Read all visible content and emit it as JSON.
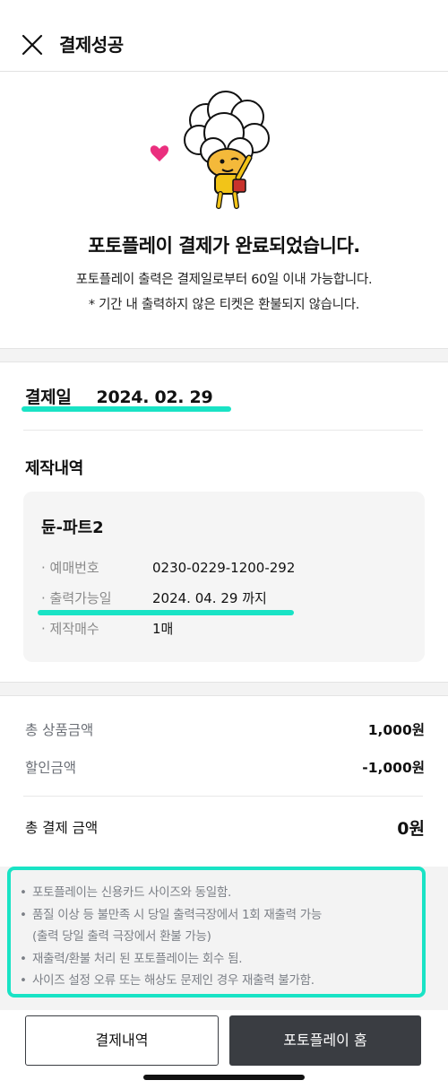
{
  "header": {
    "title": "결제성공",
    "close_icon": "close-icon"
  },
  "hero": {
    "mascot_icon": "popcorn-mascot-heart-icon",
    "title": "포토플레이 결제가 완료되었습니다.",
    "sub1": "포토플레이 출력은 결제일로부터 60일 이내 가능합니다.",
    "sub2": "* 기간 내 출력하지 않은 티켓은 환불되지 않습니다."
  },
  "payment": {
    "date_label": "결제일",
    "date_value": "2024. 02. 29"
  },
  "production": {
    "title": "제작내역",
    "ticket_name": "듄-파트2",
    "rows": [
      {
        "label": "· 예매번호",
        "value": "0230-0229-1200-292"
      },
      {
        "label": "· 출력가능일",
        "value": "2024. 04. 29 까지"
      },
      {
        "label": "· 제작매수",
        "value": "1매"
      }
    ]
  },
  "pricing": {
    "subtotal_label": "총 상품금액",
    "subtotal_value": "1,000원",
    "discount_label": "할인금액",
    "discount_value": "-1,000원",
    "total_label": "총 결제 금액",
    "total_value": "0원"
  },
  "notices": [
    "포토플레이는 신용카드 사이즈와 동일함.",
    "품질 이상 등 불만족 시 당일 출력극장에서 1회 재출력 가능",
    "(출력 당일 출력 극장에서 환불 가능)",
    "재출력/환불 처리 된 포토플레이는 회수 됨.",
    "사이즈 설정 오류 또는 해상도 문제인 경우 재출력 불가함."
  ],
  "buttons": {
    "history_label": "결제내역",
    "home_label": "포토플레이 홈"
  },
  "colors": {
    "highlight": "#19e3c5",
    "dark_button": "#3a3d42",
    "heart": "#ea2f7e"
  }
}
